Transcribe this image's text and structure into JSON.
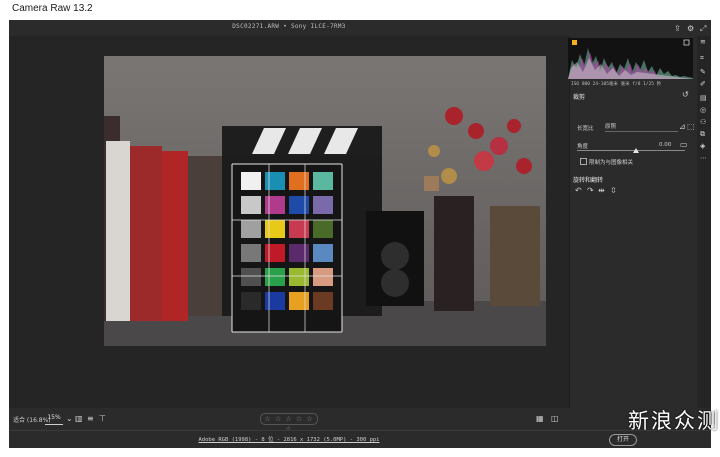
{
  "window": {
    "title": "Camera Raw 13.2"
  },
  "topbar": {
    "filename": "DSC02271.ARW • Sony ILCE-7RM3"
  },
  "bottombar": {
    "zoom_label": "适合 (16.8%)",
    "zoom_value": "15%",
    "rating_stars": "☆ ☆ ☆ ☆ ☆ ☆"
  },
  "footer": {
    "file_info": "Adobe RGB (1998) - 8 位 - 2816 x 1732 (5.0MP) - 300 ppi",
    "open_button": "打开"
  },
  "histogram": {
    "exposure_info": "ISO 800     24-105毫米 毫米     f/8     1/25 秒"
  },
  "panel": {
    "section_title": "裁剪",
    "aspect_label": "长宽比",
    "aspect_value": "原照",
    "angle_label": "角度",
    "angle_value": "0.00",
    "constrain_label": "限制为与图像相关",
    "rotate_title": "旋转和翻转"
  },
  "watermark": {
    "text": "新浪众测"
  }
}
